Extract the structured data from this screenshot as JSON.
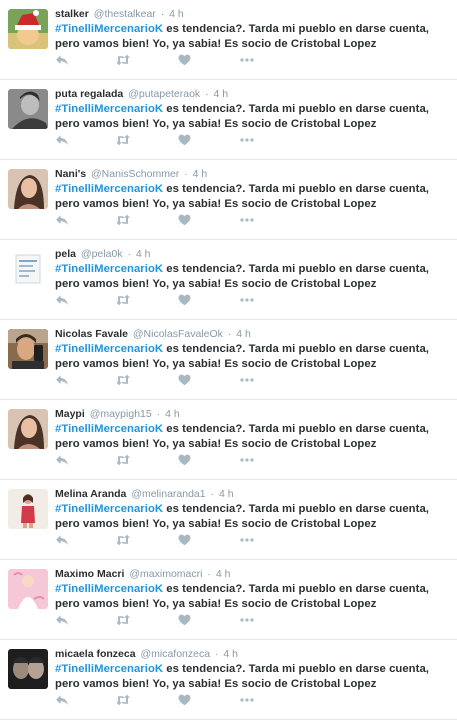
{
  "colors": {
    "hashtag": "#1b95e0",
    "meta": "#8899a6",
    "action_icon": "#aab8c2",
    "divider": "#e1e8ed"
  },
  "tweets": [
    {
      "name": "stalker",
      "handle": "@thestalkear",
      "sep": "·",
      "time": "4 h",
      "hashtag": "#TinelliMercenarioK",
      "text_rest": " es tendencia?. Tarda mi pueblo en darse cuenta, pero vamos bien! Yo, ya sabia! Es socio de Cristobal Lopez",
      "avatar": "avatar-santa-hat"
    },
    {
      "name": "puta regalada",
      "handle": "@putapeteraok",
      "sep": "·",
      "time": "4 h",
      "hashtag": "#TinelliMercenarioK",
      "text_rest": " es tendencia?. Tarda mi pueblo en darse cuenta, pero vamos bien! Yo, ya sabia! Es socio de Cristobal Lopez",
      "avatar": "avatar-grayscale-portrait"
    },
    {
      "name": "Nani's",
      "handle": "@NanisSchommer",
      "sep": "·",
      "time": "4 h",
      "hashtag": "#TinelliMercenarioK",
      "text_rest": " es tendencia?. Tarda mi pueblo en darse cuenta, pero vamos bien! Yo, ya sabia! Es socio de Cristobal Lopez",
      "avatar": "avatar-portrait"
    },
    {
      "name": "pela",
      "handle": "@pela0k",
      "sep": "·",
      "time": "4 h",
      "hashtag": "#TinelliMercenarioK",
      "text_rest": " es tendencia?. Tarda mi pueblo en darse cuenta, pero vamos bien! Yo, ya sabia! Es socio de Cristobal Lopez",
      "avatar": "avatar-document"
    },
    {
      "name": "Nicolas Favale",
      "handle": "@NicolasFavaleOk",
      "sep": "·",
      "time": "4 h",
      "hashtag": "#TinelliMercenarioK",
      "text_rest": " es tendencia?. Tarda mi pueblo en darse cuenta, pero vamos bien! Yo, ya sabia! Es socio de Cristobal Lopez",
      "avatar": "avatar-selfie"
    },
    {
      "name": "Maypi",
      "handle": "@maypigh15",
      "sep": "·",
      "time": "4 h",
      "hashtag": "#TinelliMercenarioK",
      "text_rest": " es tendencia?. Tarda mi pueblo en darse cuenta, pero vamos bien! Yo, ya sabia! Es socio de Cristobal Lopez",
      "avatar": "avatar-portrait"
    },
    {
      "name": "Melina Aranda",
      "handle": "@melinaranda1",
      "sep": "·",
      "time": "4 h",
      "hashtag": "#TinelliMercenarioK",
      "text_rest": " es tendencia?. Tarda mi pueblo en darse cuenta, pero vamos bien! Yo, ya sabia! Es socio de Cristobal Lopez",
      "avatar": "avatar-standing-figure"
    },
    {
      "name": "Maximo Macri",
      "handle": "@maximomacri",
      "sep": "·",
      "time": "4 h",
      "hashtag": "#TinelliMercenarioK",
      "text_rest": " es tendencia?. Tarda mi pueblo en darse cuenta, pero vamos bien! Yo, ya sabia! Es socio de Cristobal Lopez",
      "avatar": "avatar-pink-figure"
    },
    {
      "name": "micaela fonzeca",
      "handle": "@micafonzeca",
      "sep": "·",
      "time": "4 h",
      "hashtag": "#TinelliMercenarioK",
      "text_rest": " es tendencia?. Tarda mi pueblo en darse cuenta, pero vamos bien! Yo, ya sabia! Es socio de Cristobal Lopez",
      "avatar": "avatar-dark-portrait"
    }
  ],
  "actions": {
    "reply_icon": "reply-icon",
    "retweet_icon": "retweet-icon",
    "like_icon": "heart-icon",
    "more_icon": "more-icon"
  }
}
